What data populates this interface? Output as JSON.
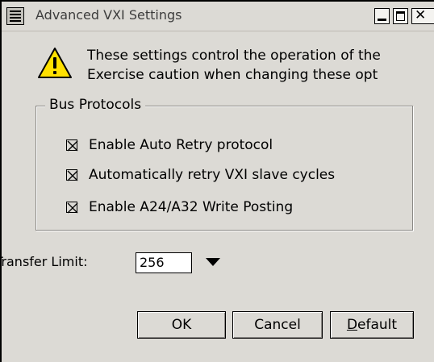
{
  "window": {
    "title": "Advanced VXI Settings"
  },
  "warning": {
    "icon": "warning-icon",
    "line1": "These settings control the operation of the",
    "line2": "Exercise caution when changing these opt"
  },
  "bus_protocols": {
    "title": "Bus Protocols",
    "options": [
      {
        "label": "Enable Auto Retry protocol",
        "checked": true
      },
      {
        "label": "Automatically retry VXI slave cycles",
        "checked": true
      },
      {
        "label": "Enable A24/A32 Write Posting",
        "checked": true
      }
    ]
  },
  "transfer_limit": {
    "label": "Transfer Limit:",
    "value": "256"
  },
  "buttons": {
    "ok": "OK",
    "cancel": "Cancel",
    "default_mnemonic": "D",
    "default_rest": "efault"
  }
}
